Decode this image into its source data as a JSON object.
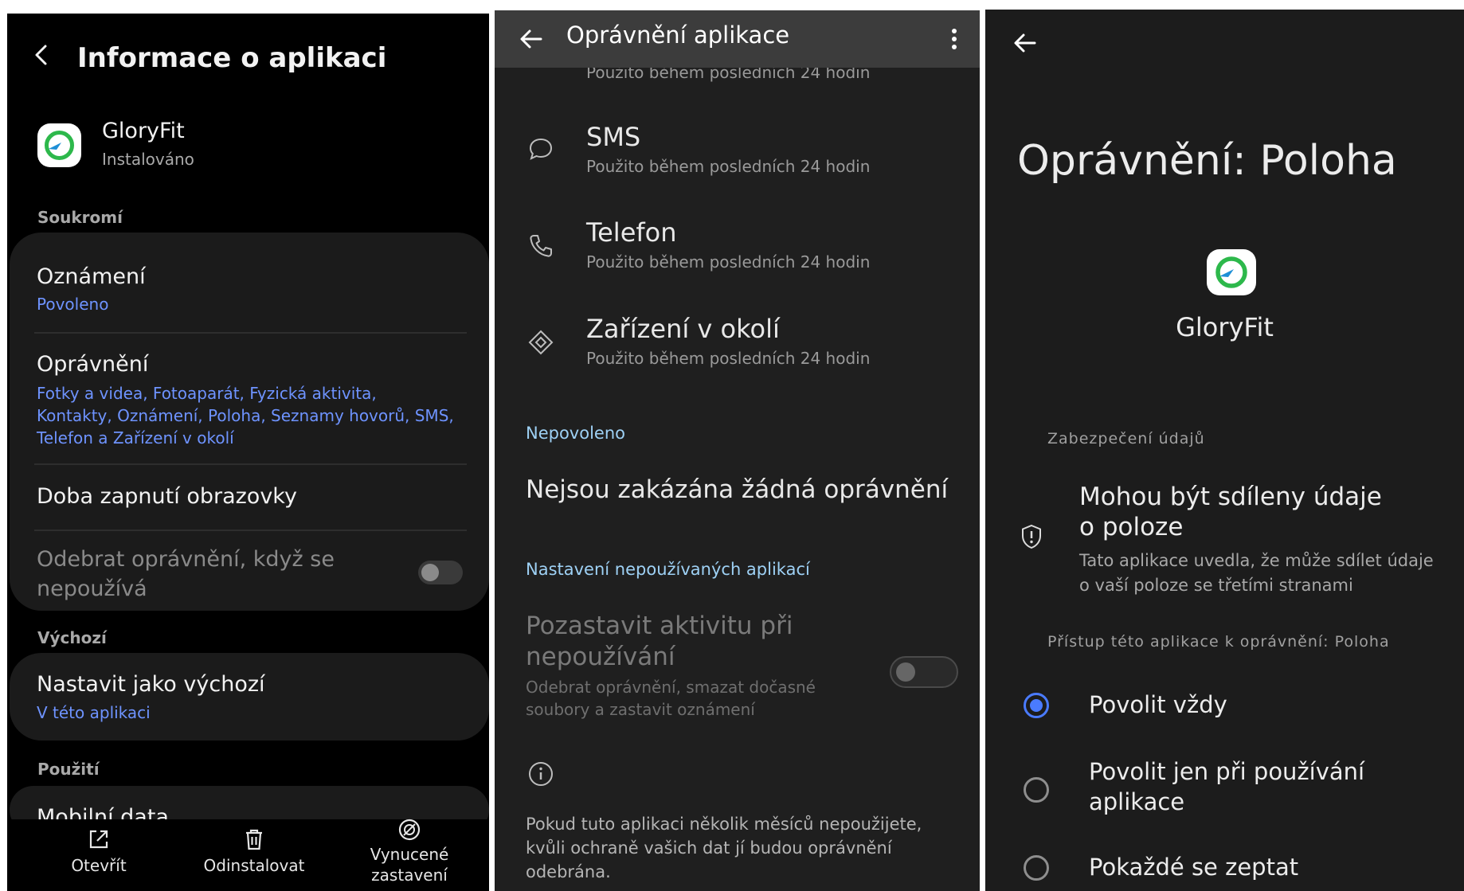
{
  "screen1": {
    "title": "Informace o aplikaci",
    "app_name": "GloryFit",
    "app_status": "Instalováno",
    "section_privacy": "Soukromí",
    "notifications": {
      "label": "Oznámení",
      "value": "Povoleno"
    },
    "permissions": {
      "label": "Oprávnění",
      "value_lines": [
        "Fotky a videa, Fotoaparát, Fyzická aktivita,",
        "Kontakty, Oznámení, Poloha, Seznamy hovorů, SMS,",
        "Telefon a Zařízení v okolí"
      ]
    },
    "screen_time": "Doba zapnutí obrazovky",
    "remove_permissions": {
      "lines": [
        "Odebrat oprávnění, když se",
        "nepoužívá"
      ],
      "enabled": false
    },
    "section_default": "Výchozí",
    "set_default": {
      "label": "Nastavit jako výchozí",
      "value": "V této aplikaci"
    },
    "section_usage": "Použití",
    "mobile_data_partial": "Mobilní data",
    "bottom_bar": [
      {
        "label": "Otevřít",
        "icon": "open-external-icon"
      },
      {
        "label": "Odinstalovat",
        "icon": "trash-icon"
      },
      {
        "label_lines": [
          "Vynucené",
          "zastavení"
        ],
        "icon": "force-stop-icon"
      }
    ]
  },
  "screen2": {
    "title": "Oprávnění aplikace",
    "partial_top_text": "Použito během posledních 24 hodin",
    "items": [
      {
        "label": "SMS",
        "sub": "Použito během posledních 24 hodin",
        "icon": "chat-bubble-icon"
      },
      {
        "label": "Telefon",
        "sub": "Použito během posledních 24 hodin",
        "icon": "phone-icon"
      },
      {
        "label": "Zařízení v okolí",
        "sub": "Použito během posledních 24 hodin",
        "icon": "nearby-devices-icon"
      }
    ],
    "section_denied": "Nepovoleno",
    "none_denied": "Nejsou zakázána žádná oprávnění",
    "section_unused": "Nastavení nepoužívaných aplikací",
    "pause_activity": {
      "lines": [
        "Pozastavit aktivitu při",
        "nepoužívání"
      ],
      "sub_lines": [
        "Odebrat oprávnění, smazat dočasné",
        "soubory a zastavit oznámení"
      ],
      "enabled": false
    },
    "info_lines": [
      "Pokud tuto aplikaci několik měsíců nepoužijete,",
      "kvůli ochraně vašich dat jí budou oprávnění",
      "odebrána."
    ]
  },
  "screen3": {
    "title": "Oprávnění: Poloha",
    "app_name": "GloryFit",
    "section_data": "Zabezpečení údajů",
    "data_share": {
      "title_lines": [
        "Mohou být sdíleny údaje",
        "o poloze"
      ],
      "sub_lines": [
        "Tato aplikace uvedla, že může sdílet údaje",
        "o vaší poloze se třetími stranami"
      ]
    },
    "section_access": "Přístup této aplikace k oprávnění: Poloha",
    "options": [
      {
        "lines": [
          "Povolit vždy"
        ],
        "selected": true
      },
      {
        "lines": [
          "Povolit jen při používání",
          "aplikace"
        ],
        "selected": false
      },
      {
        "lines": [
          "Pokaždé se zeptat"
        ],
        "selected": false
      }
    ]
  },
  "colors": {
    "accent": "#6e93ff",
    "radio_selected": "#4a7bff",
    "app_icon_green": "#2db84b"
  }
}
